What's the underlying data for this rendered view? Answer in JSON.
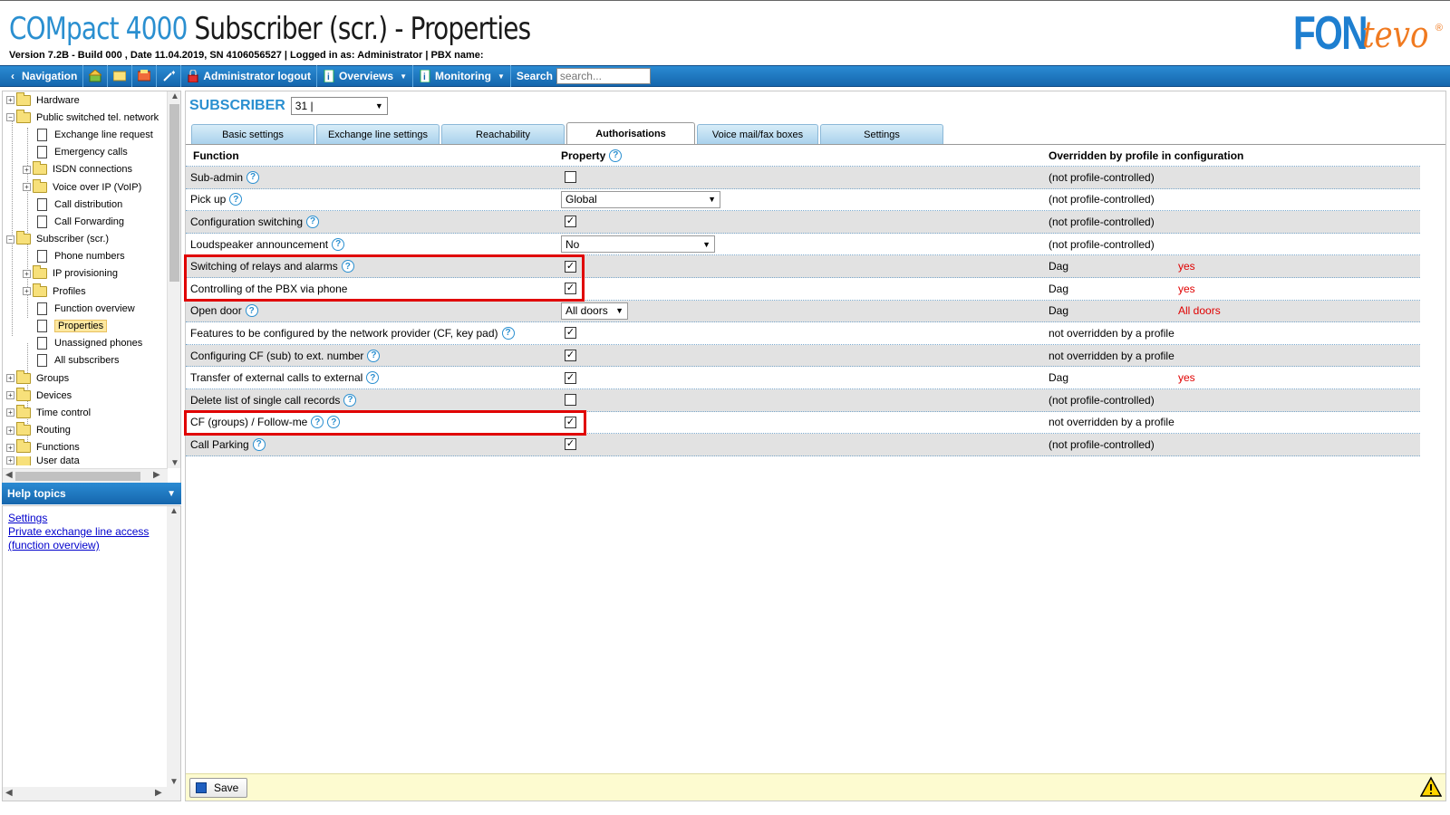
{
  "header": {
    "title_product": "COMpact 4000",
    "title_page": "Subscriber (scr.) - Properties",
    "version_line": "Version 7.2B - Build 000 ,  Date 11.04.2019,  SN 4106056527 |  Logged in as: Administrator |  PBX name:",
    "logo_fon": "FON",
    "logo_tevo": "tevo",
    "logo_reg": "®"
  },
  "toolbar": {
    "navigation": "Navigation",
    "admin_logout": "Administrator logout",
    "overviews": "Overviews",
    "monitoring": "Monitoring",
    "search_label": "Search",
    "search_placeholder": "search..."
  },
  "tree": {
    "items": [
      {
        "label": "Hardware"
      },
      {
        "label": "Public switched tel. network"
      },
      {
        "label": "Exchange line request"
      },
      {
        "label": "Emergency calls"
      },
      {
        "label": "ISDN connections"
      },
      {
        "label": "Voice over IP (VoIP)"
      },
      {
        "label": "Call distribution"
      },
      {
        "label": "Call Forwarding"
      },
      {
        "label": "Subscriber (scr.)"
      },
      {
        "label": "Phone numbers"
      },
      {
        "label": "IP provisioning"
      },
      {
        "label": "Profiles"
      },
      {
        "label": "Function overview"
      },
      {
        "label": "Properties"
      },
      {
        "label": "Unassigned phones"
      },
      {
        "label": "All subscribers"
      },
      {
        "label": "Groups"
      },
      {
        "label": "Devices"
      },
      {
        "label": "Time control"
      },
      {
        "label": "Routing"
      },
      {
        "label": "Functions"
      },
      {
        "label": "User data"
      }
    ]
  },
  "help": {
    "title": "Help topics",
    "links": [
      "Settings",
      "Private exchange line access",
      "(function overview)"
    ]
  },
  "main": {
    "title": "SUBSCRIBER",
    "subscriber_value": "31 |",
    "tabs": [
      "Basic settings",
      "Exchange line settings",
      "Reachability",
      "Authorisations",
      "Voice mail/fax boxes",
      "Settings"
    ],
    "headers": {
      "function": "Function",
      "property": "Property",
      "overridden": "Overridden by profile in configuration"
    },
    "rows": [
      {
        "function": "Sub-admin",
        "override": "(not profile-controlled)",
        "profile_value": ""
      },
      {
        "function": "Pick up",
        "select": "Global",
        "override": "(not profile-controlled)",
        "profile_value": ""
      },
      {
        "function": "Configuration switching",
        "override": "(not profile-controlled)",
        "profile_value": ""
      },
      {
        "function": "Loudspeaker announcement",
        "select": "No",
        "override": "(not profile-controlled)",
        "profile_value": ""
      },
      {
        "function": "Switching of relays and alarms",
        "override": "Dag",
        "profile_value": "yes"
      },
      {
        "function": "Controlling of the PBX via phone",
        "override": "Dag",
        "profile_value": "yes"
      },
      {
        "function": "Open door",
        "select": "All doors",
        "override": "Dag",
        "profile_value": "All doors"
      },
      {
        "function": "Features to be configured by the network provider (CF, key pad)",
        "override": "not overridden by a profile",
        "profile_value": ""
      },
      {
        "function": "Configuring CF (sub) to ext. number",
        "override": "not overridden by a profile",
        "profile_value": ""
      },
      {
        "function": "Transfer of external calls to external",
        "override": "Dag",
        "profile_value": "yes"
      },
      {
        "function": "Delete list of single call records",
        "override": "(not profile-controlled)",
        "profile_value": ""
      },
      {
        "function": "CF (groups) / Follow-me",
        "override": "not overridden by a profile",
        "profile_value": ""
      },
      {
        "function": "Call Parking",
        "override": "(not profile-controlled)",
        "profile_value": ""
      }
    ],
    "checkbox_states": [
      false,
      null,
      true,
      null,
      true,
      true,
      null,
      true,
      true,
      true,
      false,
      true,
      true
    ],
    "save_label": "Save"
  },
  "colors": {
    "accent": "#2a8fd0",
    "toolbar": "#1566ad",
    "highlight_red": "#e00000",
    "logo_blue": "#1e7fd0",
    "logo_orange": "#f07a20"
  }
}
